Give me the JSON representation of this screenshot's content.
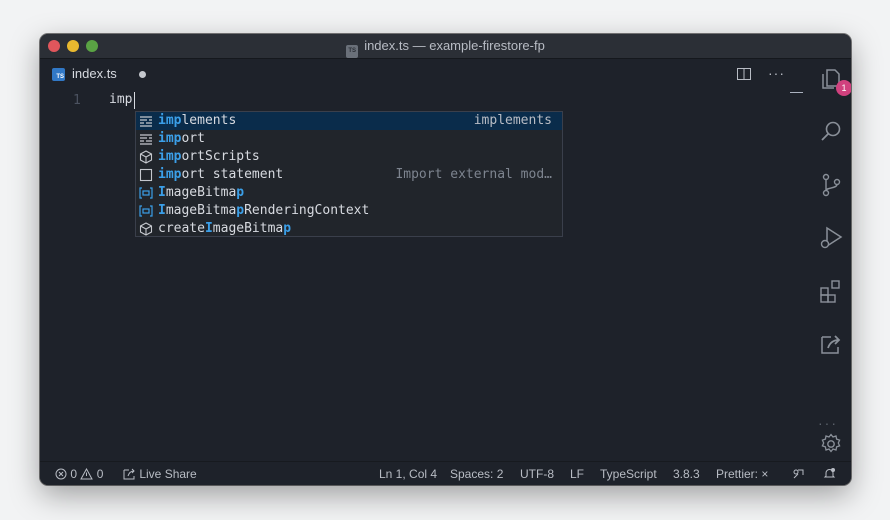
{
  "window": {
    "title": "index.ts — example-firestore-fp"
  },
  "tab": {
    "label": "index.ts",
    "icon": "typescript-file-icon",
    "modified": true
  },
  "editor": {
    "line_number": "1",
    "code": "imp"
  },
  "suggestions": [
    {
      "prefix": "imp",
      "rest": "lements",
      "detail": "implements",
      "icon": "keyword-icon",
      "selected": true
    },
    {
      "prefix": "imp",
      "rest": "ort",
      "detail": "",
      "icon": "keyword-icon",
      "selected": false
    },
    {
      "prefix": "imp",
      "rest": "ortScripts",
      "detail": "",
      "icon": "method-cube-icon",
      "selected": false
    },
    {
      "prefix": "imp",
      "rest": "ort statement",
      "detail": "Import external mod…",
      "icon": "snippet-icon",
      "selected": false
    },
    {
      "prefix": "I",
      "mid": "mageBitma",
      "prefix2": "p",
      "rest": "",
      "detail": "",
      "icon": "variable-icon",
      "selected": false
    },
    {
      "prefix": "I",
      "mid": "mageBitma",
      "prefix2": "p",
      "rest": "RenderingContext",
      "detail": "",
      "icon": "variable-icon",
      "selected": false
    },
    {
      "pre": "create",
      "prefix": "I",
      "mid": "mageBitma",
      "prefix2": "p",
      "rest": "",
      "detail": "",
      "icon": "method-cube-icon",
      "selected": false
    }
  ],
  "activity_bar": {
    "explorer_badge": "1"
  },
  "status_bar": {
    "errors": "0",
    "warnings": "0",
    "live_share": "Live Share",
    "position": "Ln 1, Col 4",
    "spaces": "Spaces: 2",
    "encoding": "UTF-8",
    "eol": "LF",
    "language": "TypeScript",
    "ts_version": "3.8.3",
    "prettier": "Prettier: ×"
  },
  "colors": {
    "accent_highlight": "#3b9fe8",
    "selection_bg": "#0a2c4b",
    "badge": "#d0417e"
  }
}
